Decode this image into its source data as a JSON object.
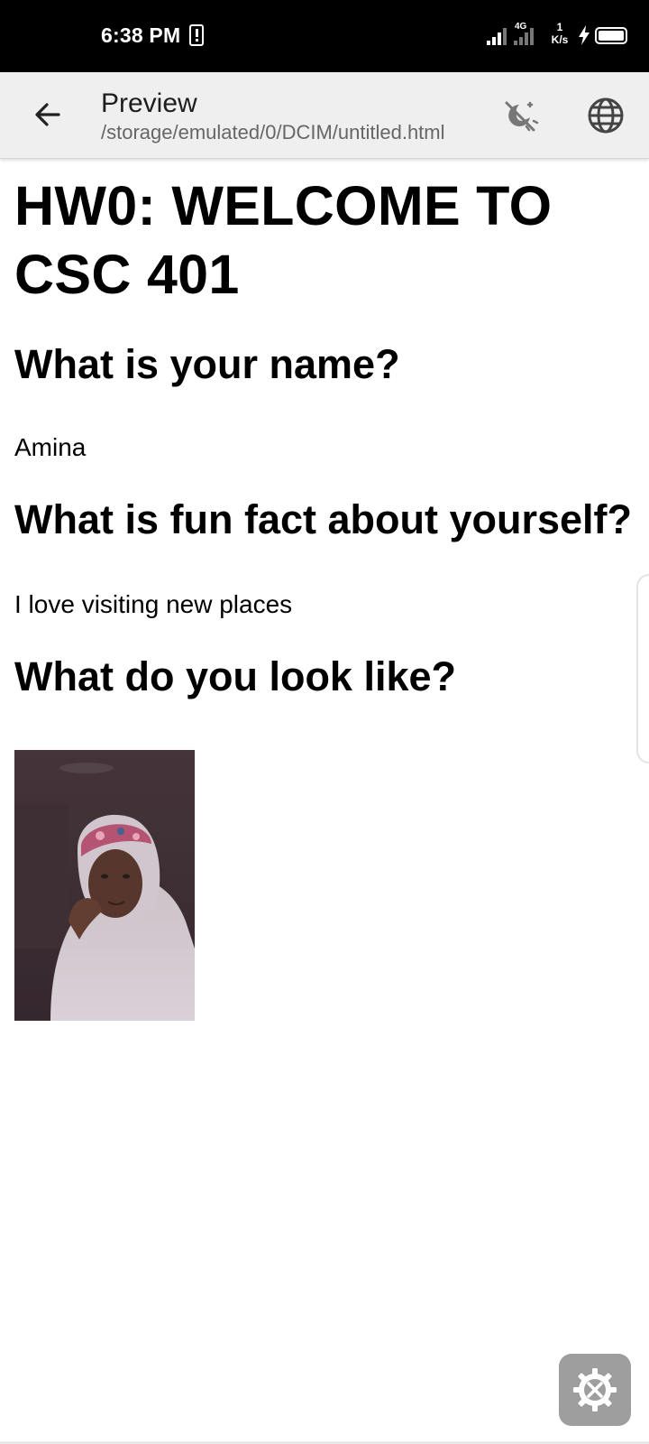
{
  "status_bar": {
    "time": "6:38 PM",
    "network_type": "4G",
    "speed_value": "1",
    "speed_unit": "K/s",
    "icons": [
      "sim-alert-icon",
      "signal-icon",
      "signal-4g-icon",
      "charging-icon",
      "battery-icon"
    ]
  },
  "app_bar": {
    "title": "Preview",
    "path": "/storage/emulated/0/DCIM/untitled.html",
    "icons": [
      "back-arrow-icon",
      "night-mode-icon",
      "globe-icon"
    ]
  },
  "document": {
    "title": "HW0: WELCOME TO CSC 401",
    "sections": [
      {
        "question": "What is your name?",
        "answer": "Amina"
      },
      {
        "question": "What is fun fact about yourself?",
        "answer": "I love visiting new places"
      },
      {
        "question": "What do you look like?"
      }
    ]
  },
  "floating_button": {
    "icon": "gear-tools-icon"
  },
  "colors": {
    "status_bar": "#000000",
    "app_bar": "#efefef",
    "tool_button": "#9e9e9e"
  }
}
